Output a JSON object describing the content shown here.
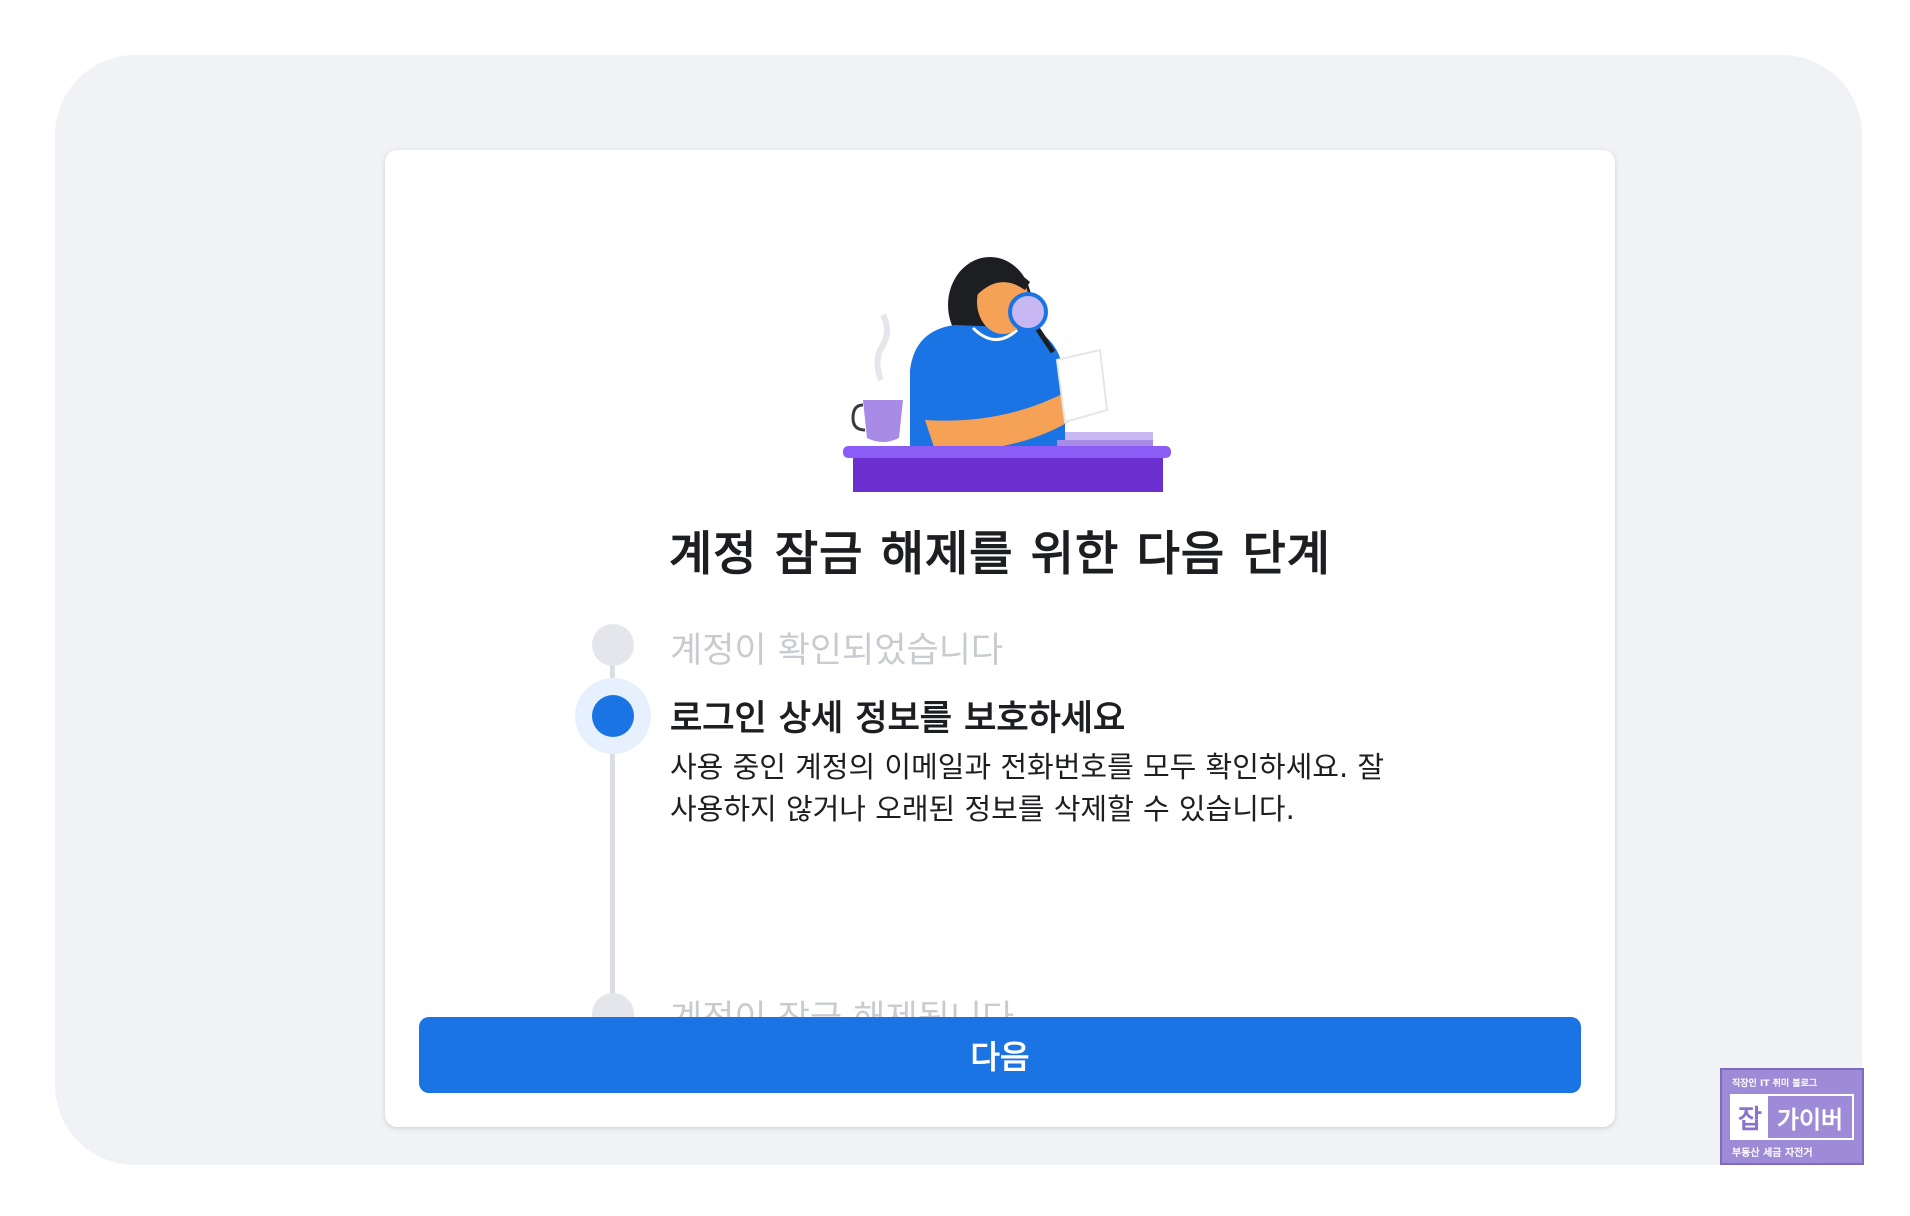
{
  "card": {
    "title": "계정 잠금 해제를 위한 다음 단계",
    "steps": [
      {
        "label": "계정이 확인되었습니다",
        "state": "done"
      },
      {
        "label": "로그인 상세 정보를 보호하세요",
        "state": "current",
        "description": "사용 중인 계정의 이메일과 전화번호를 모두 확인하세요. 잘 사용하지 않거나 오래된 정보를 삭제할 수 있습니다."
      },
      {
        "label": "계정이 잠금 해제됩니다",
        "state": "upcoming"
      }
    ],
    "next_button": "다음"
  },
  "watermark": {
    "top_text": "직장인 IT 취미 블로그",
    "logo_char": "잡",
    "name": "가이버",
    "bottom_text": "부동산 세금 자전거"
  },
  "colors": {
    "accent": "#1b74e4",
    "inactive": "#c8ccd1",
    "page_bg": "#f0f2f5",
    "illustration_purple": "#6b2fd0",
    "illustration_blue": "#1b74e4",
    "illustration_skin": "#f5a256"
  },
  "icons": {
    "illustration": "woman-with-magnifying-glass-illustration"
  }
}
